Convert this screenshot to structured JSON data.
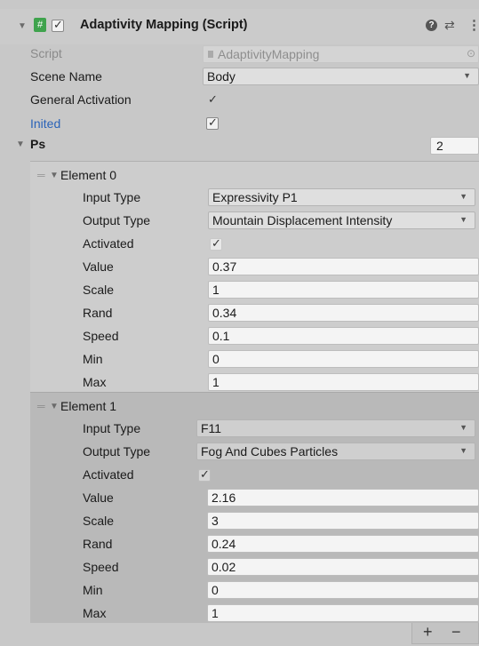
{
  "component": {
    "title": "Adaptivity Mapping (Script)",
    "enabled_check": "✓",
    "script_label": "Script",
    "script_value": "AdaptivityMapping",
    "scene_name_label": "Scene Name",
    "scene_name_value": "Body",
    "general_activation_label": "General Activation",
    "general_activation_check": "✓",
    "inited_label": "Inited",
    "inited_check": "✓",
    "ps_label": "Ps",
    "ps_size": "2"
  },
  "elements": [
    {
      "header": "Element 0",
      "input_type_label": "Input Type",
      "input_type_value": "Expressivity P1",
      "output_type_label": "Output Type",
      "output_type_value": "Mountain Displacement Intensity",
      "activated_label": "Activated",
      "activated_check": "✓",
      "value_label": "Value",
      "value": "0.37",
      "scale_label": "Scale",
      "scale": "1",
      "rand_label": "Rand",
      "rand": "0.34",
      "speed_label": "Speed",
      "speed": "0.1",
      "min_label": "Min",
      "min": "0",
      "max_label": "Max",
      "max": "1"
    },
    {
      "header": "Element 1",
      "input_type_label": "Input Type",
      "input_type_value": "F11",
      "output_type_label": "Output Type",
      "output_type_value": "Fog And Cubes Particles",
      "activated_label": "Activated",
      "activated_check": "✓",
      "value_label": "Value",
      "value": "2.16",
      "scale_label": "Scale",
      "scale": "3",
      "rand_label": "Rand",
      "rand": "0.24",
      "speed_label": "Speed",
      "speed": "0.02",
      "min_label": "Min",
      "min": "0",
      "max_label": "Max",
      "max": "1"
    }
  ],
  "footer": {
    "add_label": "+",
    "remove_label": "−"
  },
  "colors": {
    "inited_label": "#2a63b8",
    "script_icon": "#3fa34d"
  },
  "icons": [
    "foldout-arrow-icon",
    "script-hash-icon",
    "help-icon",
    "preset-icon",
    "menu-kebab-icon",
    "drag-handle-icon",
    "dropdown-arrow-icon"
  ]
}
